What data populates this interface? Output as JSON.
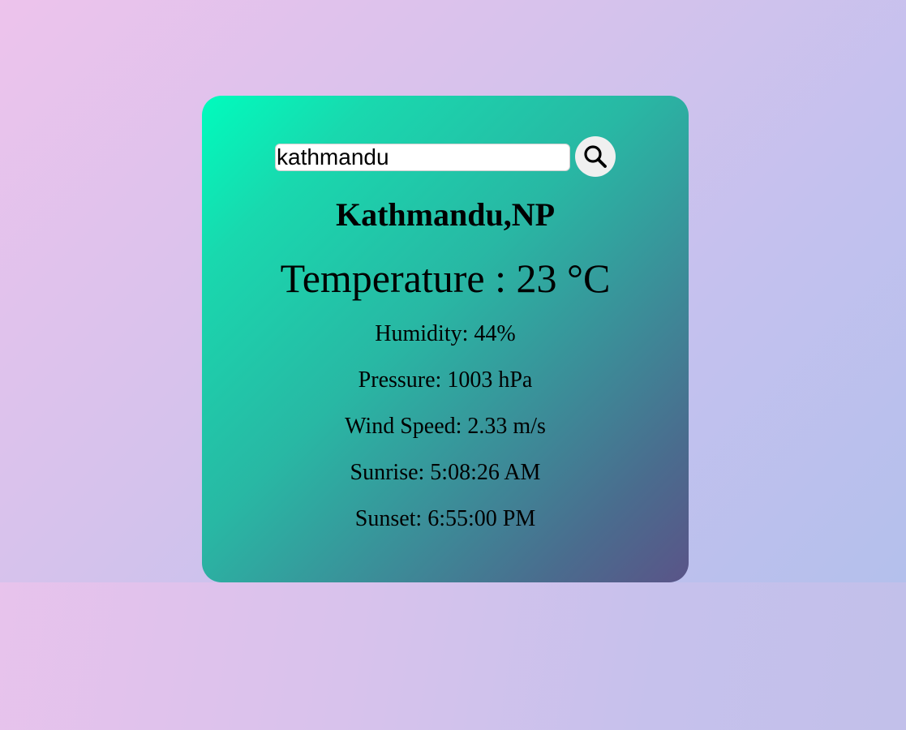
{
  "search": {
    "value": "kathmandu",
    "icon": "search-icon"
  },
  "weather": {
    "location": "Kathmandu,NP",
    "temperature": "Temperature : 23 °C",
    "humidity": "Humidity: 44%",
    "pressure": "Pressure: 1003 hPa",
    "wind_speed": "Wind Speed: 2.33 m/s",
    "sunrise": "Sunrise: 5:08:26 AM",
    "sunset": "Sunset: 6:55:00 PM"
  },
  "colors": {
    "card_gradient_start": "#00fcbd",
    "card_gradient_end": "#5a5488",
    "background_start": "#edc3ec",
    "background_end": "#b4c0ec"
  }
}
